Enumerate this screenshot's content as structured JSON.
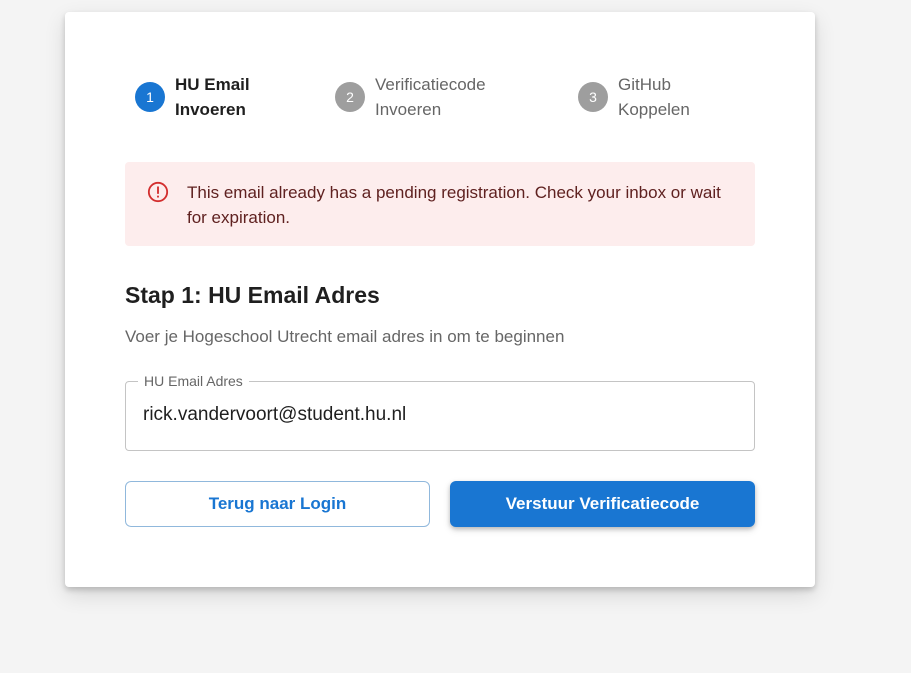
{
  "stepper": {
    "steps": [
      {
        "number": "1",
        "line1": "HU Email",
        "line2": "Invoeren",
        "state": "active"
      },
      {
        "number": "2",
        "line1": "Verificatiecode",
        "line2": "Invoeren",
        "state": "inactive"
      },
      {
        "number": "3",
        "line1": "GitHub",
        "line2": "Koppelen",
        "state": "inactive"
      }
    ]
  },
  "alert": {
    "icon": "error-outline-icon",
    "message": "This email already has a pending registration. Check your inbox or wait for expiration."
  },
  "section": {
    "title": "Stap 1: HU Email Adres",
    "subtitle": "Voer je Hogeschool Utrecht email adres in om te beginnen"
  },
  "email_field": {
    "label": "HU Email Adres",
    "value": "rick.vandervoort@student.hu.nl"
  },
  "buttons": {
    "back_label": "Terug naar Login",
    "submit_label": "Verstuur Verificatiecode"
  },
  "colors": {
    "primary": "#1976d2",
    "inactive_step": "#9e9e9e",
    "alert_background": "#fdeded",
    "alert_text": "#5f2120",
    "alert_icon": "#d32f2f"
  }
}
